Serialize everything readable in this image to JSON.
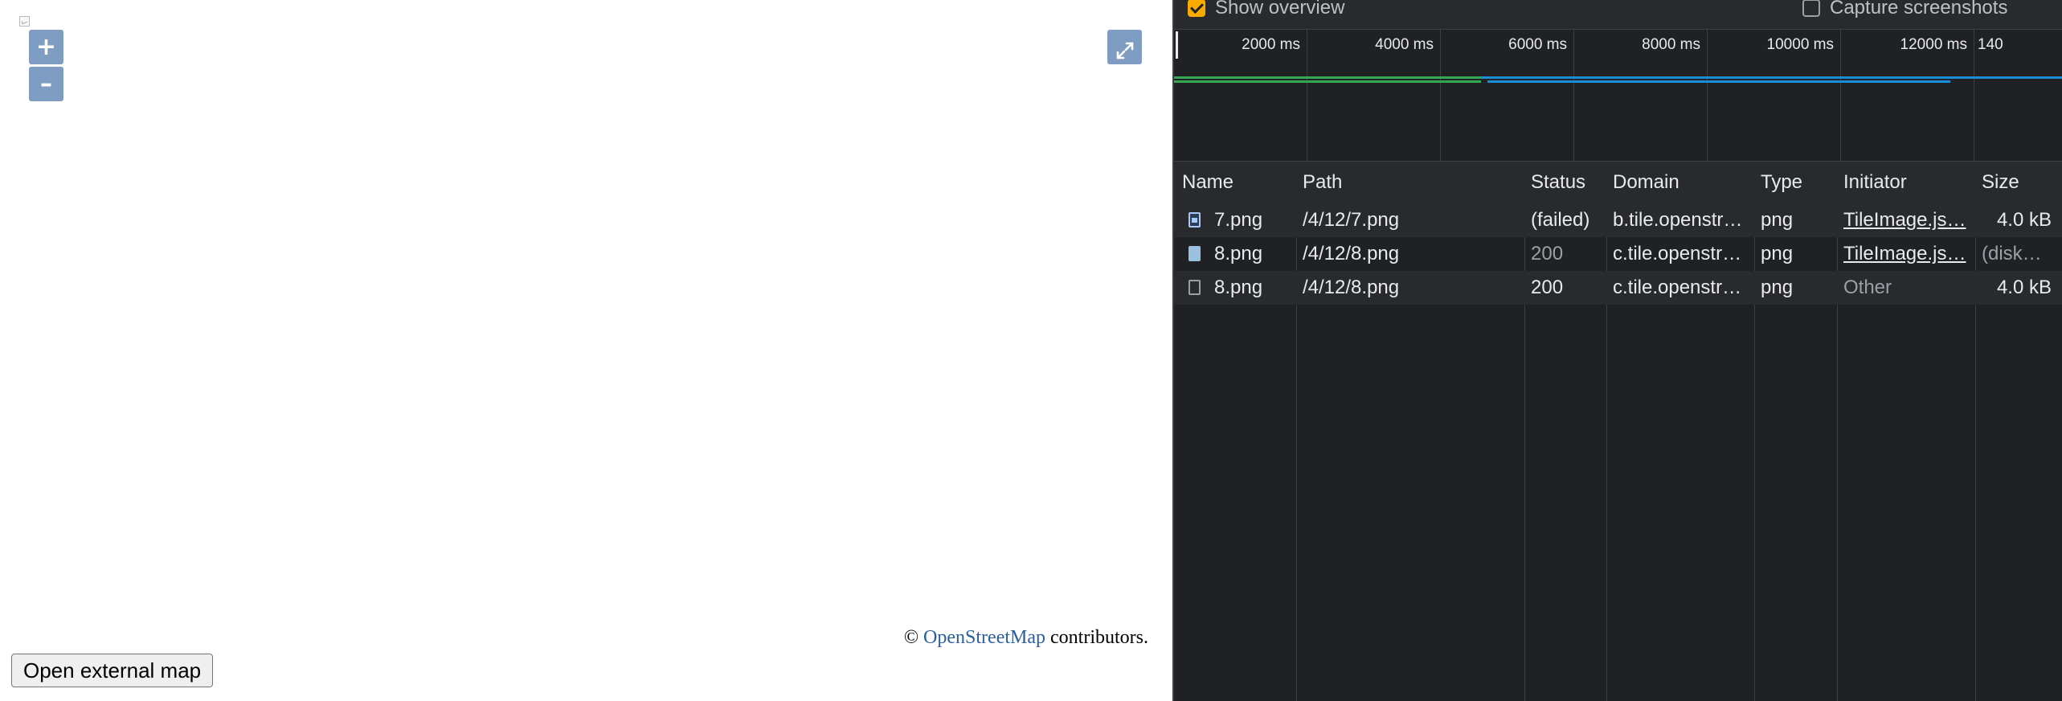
{
  "map": {
    "zoom_in_label": "+",
    "zoom_out_label": "–",
    "attribution": {
      "prefix": "©",
      "link": "OpenStreetMap",
      "suffix": "contributors."
    },
    "open_external_label": "Open external map"
  },
  "devtools": {
    "settings": {
      "show_overview": {
        "label": "Show overview",
        "checked": true
      },
      "capture_screenshots": {
        "label": "Capture screenshots",
        "checked": false
      }
    },
    "timeline_ticks": [
      "2000 ms",
      "4000 ms",
      "6000 ms",
      "8000 ms",
      "10000 ms",
      "12000 ms",
      "140"
    ],
    "columns": [
      "Name",
      "Path",
      "Status",
      "Domain",
      "Type",
      "Initiator",
      "Size"
    ],
    "rows": [
      {
        "name": "7.png",
        "path": "/4/12/7.png",
        "status": "(failed)",
        "domain": "b.tile.openstr…",
        "type": "png",
        "initiator": "TileImage.js…",
        "size": "4.0 kB"
      },
      {
        "name": "8.png",
        "path": "/4/12/8.png",
        "status": "200",
        "domain": "c.tile.openstr…",
        "type": "png",
        "initiator": "TileImage.js…",
        "size": "(disk…"
      },
      {
        "name": "8.png",
        "path": "/4/12/8.png",
        "status": "200",
        "domain": "c.tile.openstr…",
        "type": "png",
        "initiator": "Other",
        "size": "4.0 kB"
      }
    ],
    "colors": {
      "accent_checkbox": "#f9ab00",
      "overview_green": "#34a853",
      "overview_blue": "#1a8cd8",
      "background": "#202124"
    }
  }
}
